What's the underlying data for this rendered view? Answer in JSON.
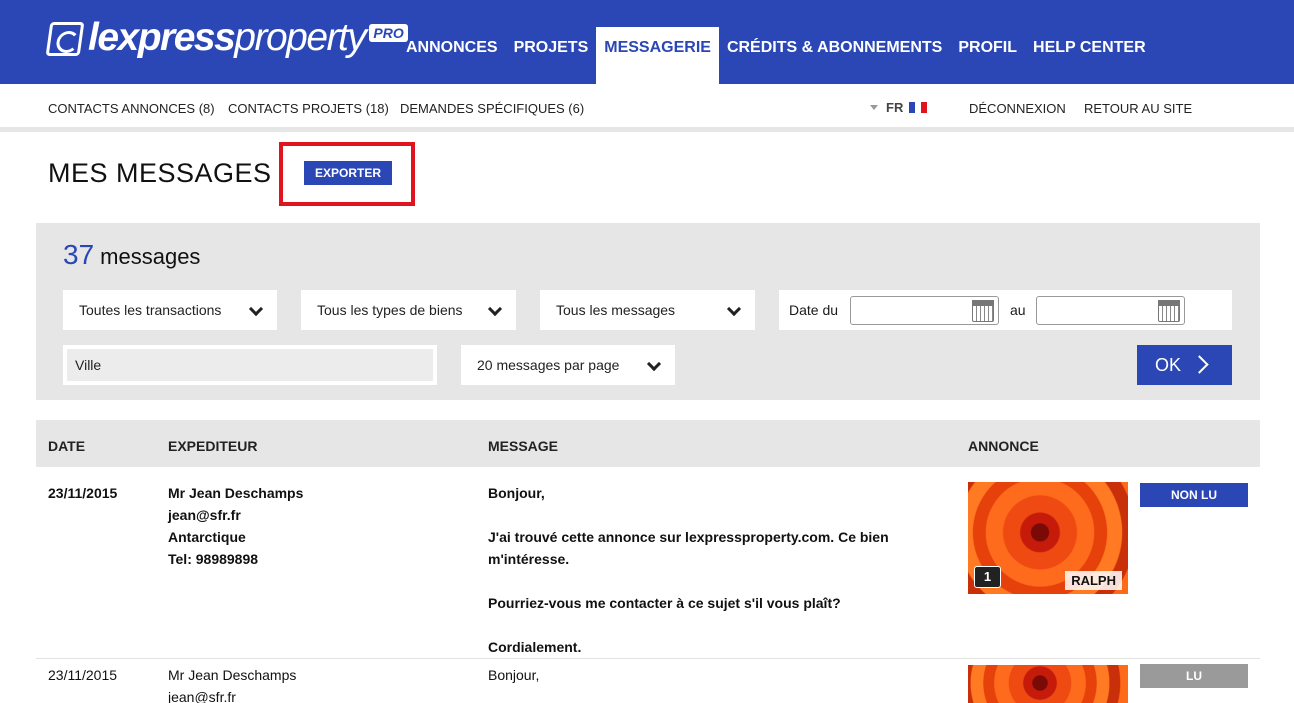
{
  "brand": {
    "logo_bold": "lexpress",
    "logo_light": "property",
    "logo_pro": "PRO"
  },
  "main_nav": [
    {
      "label": "ANNONCES",
      "active": false
    },
    {
      "label": "PROJETS",
      "active": false
    },
    {
      "label": "MESSAGERIE",
      "active": true
    },
    {
      "label": "CRÉDITS & ABONNEMENTS",
      "active": false
    },
    {
      "label": "PROFIL",
      "active": false
    },
    {
      "label": "HELP CENTER",
      "active": false
    }
  ],
  "sub_nav": {
    "contacts_annonces": "CONTACTS ANNONCES (8)",
    "contacts_projets": "CONTACTS PROJETS (18)",
    "demandes": "DEMANDES SPÉCIFIQUES (6)",
    "language": "FR",
    "logout": "DÉCONNEXION",
    "back_to_site": "RETOUR AU SITE"
  },
  "page": {
    "title": "MES MESSAGES",
    "export_label": "EXPORTER"
  },
  "filters": {
    "count": "37",
    "count_label": "messages",
    "transactions": "Toutes les transactions",
    "property_types": "Tous les types de biens",
    "messages": "Tous les messages",
    "date_from_label": "Date du",
    "date_from_value": "",
    "date_to_label": "au",
    "date_to_value": "",
    "city_value": "Ville",
    "per_page": "20 messages par page",
    "ok_label": "OK"
  },
  "table": {
    "headers": {
      "date": "DATE",
      "sender": "EXPEDITEUR",
      "message": "MESSAGE",
      "listing": "ANNONCE"
    },
    "rows": [
      {
        "date": "23/11/2015",
        "sender_name": "Mr Jean Deschamps",
        "sender_email": "jean@sfr.fr",
        "sender_location": "Antarctique",
        "sender_phone": "Tel: 98989898",
        "msg_greeting": "Bonjour,",
        "msg_body": "J'ai trouvé cette annonce sur lexpressproperty.com. Ce bien m'intéresse.",
        "msg_request": "Pourriez-vous me contacter à ce sujet s'il vous plaît?",
        "msg_closing": "Cordialement.",
        "photo_count": "1",
        "agent": "RALPH",
        "status": "NON LU",
        "status_color": "#2a47b5"
      },
      {
        "date": "23/11/2015",
        "sender_name": "Mr Jean Deschamps",
        "sender_email": "jean@sfr.fr",
        "msg_greeting": "Bonjour,",
        "status": "LU",
        "status_color": "#9a9a9a"
      }
    ]
  },
  "colors": {
    "brand_blue": "#2a47b5",
    "panel_grey": "#e6e6e6",
    "highlight_red": "#e0141e"
  }
}
